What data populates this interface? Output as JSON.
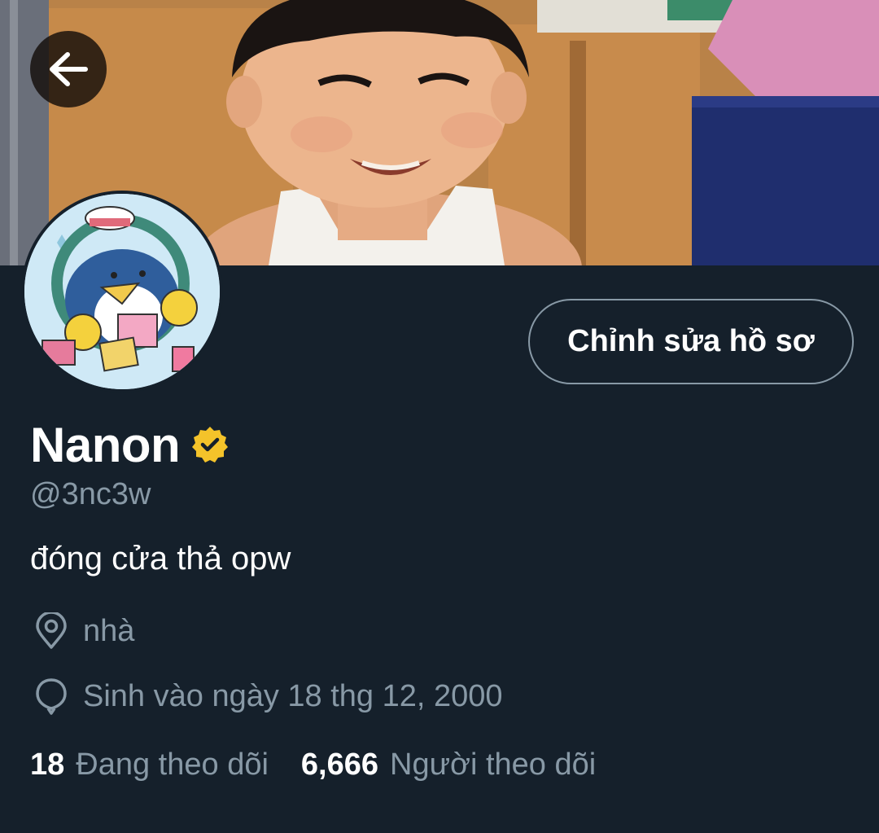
{
  "profile": {
    "display_name": "Nanon",
    "handle": "@3nc3w",
    "bio": "đóng cửa thả opw",
    "location": "nhà",
    "birth": "Sinh vào ngày 18 thg 12, 2000",
    "edit_label": "Chỉnh sửa hồ sơ",
    "verified": true
  },
  "stats": {
    "following_count": "18",
    "following_label": "Đang theo dõi",
    "followers_count": "6,666",
    "followers_label": "Người theo dõi"
  },
  "icons": {
    "back": "arrow-left-icon",
    "verified": "verified-badge-icon",
    "location": "location-pin-icon",
    "birth": "balloon-icon"
  },
  "colors": {
    "background": "#15202b",
    "secondary_text": "#8899a6",
    "verified_badge": "#f4c32a",
    "button_border": "#8899a6"
  }
}
